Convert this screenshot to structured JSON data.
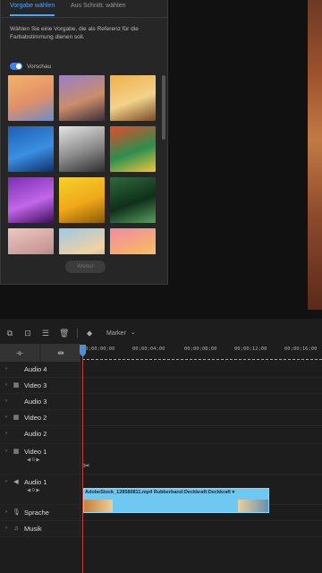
{
  "panel": {
    "tab_active": "Vorgabe wählen",
    "tab_inactive": "Aus Schnitt. wählen",
    "description": "Wählen Sie eine Vorgabe, die als Referenz für die Farbabstimmung dienen soll.",
    "toggle_label": "Vorschau",
    "toggle_on": true,
    "button_label": "Weiter",
    "thumbnails": [
      {
        "name": "sunset-lake",
        "colors": [
          "#f3b36a",
          "#e08f6a",
          "#6a8fc6"
        ]
      },
      {
        "name": "desert-road",
        "colors": [
          "#9b7ec6",
          "#c98e6b",
          "#3b2f3a"
        ]
      },
      {
        "name": "skateboarder",
        "colors": [
          "#f0b04a",
          "#f2d28a",
          "#7a4a2a"
        ]
      },
      {
        "name": "blue-feathers",
        "colors": [
          "#1c5fb7",
          "#3b8fe0",
          "#0e2f6a"
        ]
      },
      {
        "name": "gothic-arches",
        "colors": [
          "#e6e6e6",
          "#8a8a8a",
          "#2e2e2e"
        ]
      },
      {
        "name": "colorful-leaves",
        "colors": [
          "#e44b2a",
          "#2c8f4e",
          "#f2c53a"
        ]
      },
      {
        "name": "purple-flowers",
        "colors": [
          "#7b2fb0",
          "#c266e8",
          "#3a0f5a"
        ]
      },
      {
        "name": "yellow-flower",
        "colors": [
          "#f7d12b",
          "#f0a81a",
          "#8a5a0a"
        ]
      },
      {
        "name": "green-leaves",
        "colors": [
          "#2f6a3c",
          "#0f2f1a",
          "#5aa060"
        ]
      },
      {
        "name": "pink-sky",
        "colors": [
          "#f0c6c0",
          "#c89a9a",
          "#8a6060"
        ]
      },
      {
        "name": "beach-sky",
        "colors": [
          "#9fc8e8",
          "#f2d2a0",
          "#6a9ac0"
        ]
      },
      {
        "name": "paint-strokes",
        "colors": [
          "#f28aa0",
          "#f6b46a",
          "#f0e0c0"
        ]
      }
    ]
  },
  "timeline": {
    "marker_label": "Marker",
    "timecodes": [
      "00;00;00;00",
      "00;00;04;00",
      "00;00;08;00",
      "00;00;12;00",
      "00;00;16;00"
    ],
    "tracks": [
      {
        "name": "Audio 4",
        "icon": "chevron-icon",
        "type": "audio",
        "top": 0
      },
      {
        "name": "Video 3",
        "icon": "film-icon",
        "type": "video",
        "top": 0
      },
      {
        "name": "Audio 3",
        "icon": "chevron-icon",
        "type": "audio",
        "top": 0
      },
      {
        "name": "Video 2",
        "icon": "film-icon",
        "type": "video",
        "top": 0
      },
      {
        "name": "Audio 2",
        "icon": "chevron-icon",
        "type": "audio",
        "top": 0
      },
      {
        "name": "Video 1",
        "icon": "film-icon",
        "type": "video",
        "sub": "◀ 0 ▶"
      },
      {
        "name": "Audio 1",
        "icon": "speaker-icon",
        "type": "audio",
        "sub": "◀ 0 ▶"
      },
      {
        "name": "Sprache",
        "icon": "mic-icon",
        "type": "audio"
      },
      {
        "name": "Musik",
        "icon": "music-icon",
        "type": "audio"
      }
    ],
    "clip": {
      "label": "AdobeStock_128580811.mp4  Rubberband:Deckkraft:Deckkraft ▾",
      "color": "#6ec8f2"
    }
  }
}
